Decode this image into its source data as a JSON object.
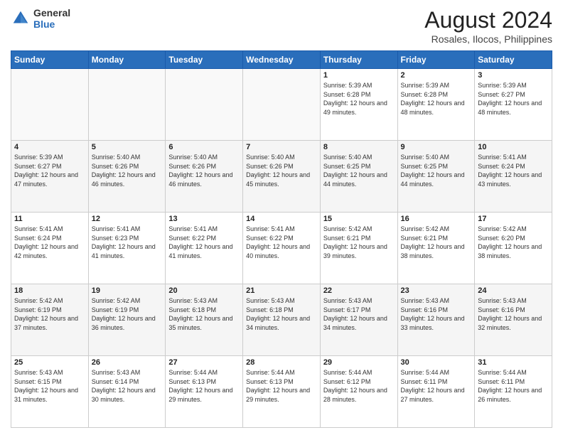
{
  "header": {
    "logo": {
      "line1": "General",
      "line2": "Blue"
    },
    "title": "August 2024",
    "location": "Rosales, Ilocos, Philippines"
  },
  "weekdays": [
    "Sunday",
    "Monday",
    "Tuesday",
    "Wednesday",
    "Thursday",
    "Friday",
    "Saturday"
  ],
  "weeks": [
    [
      {
        "day": "",
        "info": ""
      },
      {
        "day": "",
        "info": ""
      },
      {
        "day": "",
        "info": ""
      },
      {
        "day": "",
        "info": ""
      },
      {
        "day": "1",
        "info": "Sunrise: 5:39 AM\nSunset: 6:28 PM\nDaylight: 12 hours\nand 49 minutes."
      },
      {
        "day": "2",
        "info": "Sunrise: 5:39 AM\nSunset: 6:28 PM\nDaylight: 12 hours\nand 48 minutes."
      },
      {
        "day": "3",
        "info": "Sunrise: 5:39 AM\nSunset: 6:27 PM\nDaylight: 12 hours\nand 48 minutes."
      }
    ],
    [
      {
        "day": "4",
        "info": "Sunrise: 5:39 AM\nSunset: 6:27 PM\nDaylight: 12 hours\nand 47 minutes."
      },
      {
        "day": "5",
        "info": "Sunrise: 5:40 AM\nSunset: 6:26 PM\nDaylight: 12 hours\nand 46 minutes."
      },
      {
        "day": "6",
        "info": "Sunrise: 5:40 AM\nSunset: 6:26 PM\nDaylight: 12 hours\nand 46 minutes."
      },
      {
        "day": "7",
        "info": "Sunrise: 5:40 AM\nSunset: 6:26 PM\nDaylight: 12 hours\nand 45 minutes."
      },
      {
        "day": "8",
        "info": "Sunrise: 5:40 AM\nSunset: 6:25 PM\nDaylight: 12 hours\nand 44 minutes."
      },
      {
        "day": "9",
        "info": "Sunrise: 5:40 AM\nSunset: 6:25 PM\nDaylight: 12 hours\nand 44 minutes."
      },
      {
        "day": "10",
        "info": "Sunrise: 5:41 AM\nSunset: 6:24 PM\nDaylight: 12 hours\nand 43 minutes."
      }
    ],
    [
      {
        "day": "11",
        "info": "Sunrise: 5:41 AM\nSunset: 6:24 PM\nDaylight: 12 hours\nand 42 minutes."
      },
      {
        "day": "12",
        "info": "Sunrise: 5:41 AM\nSunset: 6:23 PM\nDaylight: 12 hours\nand 41 minutes."
      },
      {
        "day": "13",
        "info": "Sunrise: 5:41 AM\nSunset: 6:22 PM\nDaylight: 12 hours\nand 41 minutes."
      },
      {
        "day": "14",
        "info": "Sunrise: 5:41 AM\nSunset: 6:22 PM\nDaylight: 12 hours\nand 40 minutes."
      },
      {
        "day": "15",
        "info": "Sunrise: 5:42 AM\nSunset: 6:21 PM\nDaylight: 12 hours\nand 39 minutes."
      },
      {
        "day": "16",
        "info": "Sunrise: 5:42 AM\nSunset: 6:21 PM\nDaylight: 12 hours\nand 38 minutes."
      },
      {
        "day": "17",
        "info": "Sunrise: 5:42 AM\nSunset: 6:20 PM\nDaylight: 12 hours\nand 38 minutes."
      }
    ],
    [
      {
        "day": "18",
        "info": "Sunrise: 5:42 AM\nSunset: 6:19 PM\nDaylight: 12 hours\nand 37 minutes."
      },
      {
        "day": "19",
        "info": "Sunrise: 5:42 AM\nSunset: 6:19 PM\nDaylight: 12 hours\nand 36 minutes."
      },
      {
        "day": "20",
        "info": "Sunrise: 5:43 AM\nSunset: 6:18 PM\nDaylight: 12 hours\nand 35 minutes."
      },
      {
        "day": "21",
        "info": "Sunrise: 5:43 AM\nSunset: 6:18 PM\nDaylight: 12 hours\nand 34 minutes."
      },
      {
        "day": "22",
        "info": "Sunrise: 5:43 AM\nSunset: 6:17 PM\nDaylight: 12 hours\nand 34 minutes."
      },
      {
        "day": "23",
        "info": "Sunrise: 5:43 AM\nSunset: 6:16 PM\nDaylight: 12 hours\nand 33 minutes."
      },
      {
        "day": "24",
        "info": "Sunrise: 5:43 AM\nSunset: 6:16 PM\nDaylight: 12 hours\nand 32 minutes."
      }
    ],
    [
      {
        "day": "25",
        "info": "Sunrise: 5:43 AM\nSunset: 6:15 PM\nDaylight: 12 hours\nand 31 minutes."
      },
      {
        "day": "26",
        "info": "Sunrise: 5:43 AM\nSunset: 6:14 PM\nDaylight: 12 hours\nand 30 minutes."
      },
      {
        "day": "27",
        "info": "Sunrise: 5:44 AM\nSunset: 6:13 PM\nDaylight: 12 hours\nand 29 minutes."
      },
      {
        "day": "28",
        "info": "Sunrise: 5:44 AM\nSunset: 6:13 PM\nDaylight: 12 hours\nand 29 minutes."
      },
      {
        "day": "29",
        "info": "Sunrise: 5:44 AM\nSunset: 6:12 PM\nDaylight: 12 hours\nand 28 minutes."
      },
      {
        "day": "30",
        "info": "Sunrise: 5:44 AM\nSunset: 6:11 PM\nDaylight: 12 hours\nand 27 minutes."
      },
      {
        "day": "31",
        "info": "Sunrise: 5:44 AM\nSunset: 6:11 PM\nDaylight: 12 hours\nand 26 minutes."
      }
    ]
  ]
}
